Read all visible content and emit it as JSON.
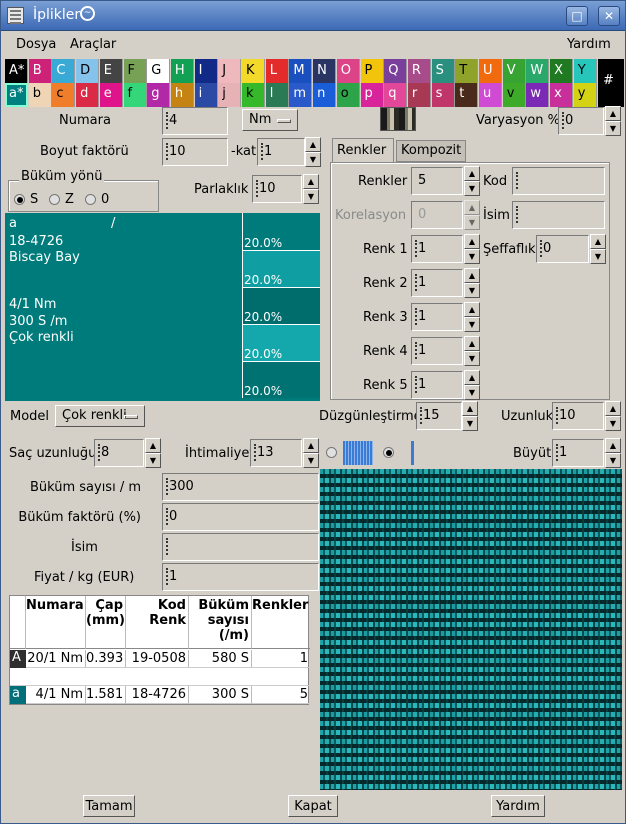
{
  "window": {
    "title": "İplikler"
  },
  "menubar": {
    "dosya": "Dosya",
    "araclar": "Araçlar",
    "yardim": "Yardım"
  },
  "palette": {
    "top": [
      {
        "label": "A*",
        "bg": "#000000",
        "fg": "#ffffff"
      },
      {
        "label": "B",
        "bg": "#cc2277",
        "fg": "#ffffff"
      },
      {
        "label": "C",
        "bg": "#39a9d6",
        "fg": "#ffffff"
      },
      {
        "label": "D",
        "bg": "#86c3ec",
        "fg": "#000000"
      },
      {
        "label": "E",
        "bg": "#444444",
        "fg": "#ffffff"
      },
      {
        "label": "F",
        "bg": "#77a255",
        "fg": "#000000"
      },
      {
        "label": "G",
        "bg": "#ffffff",
        "fg": "#000000"
      },
      {
        "label": "H",
        "bg": "#12a054",
        "fg": "#ffffff"
      },
      {
        "label": "I",
        "bg": "#112a88",
        "fg": "#ffffff"
      },
      {
        "label": "J",
        "bg": "#efb8bd",
        "fg": "#000000"
      },
      {
        "label": "K",
        "bg": "#f3d92a",
        "fg": "#000000"
      },
      {
        "label": "L",
        "bg": "#e42b2b",
        "fg": "#ffffff"
      },
      {
        "label": "M",
        "bg": "#1a4fc0",
        "fg": "#ffffff"
      },
      {
        "label": "N",
        "bg": "#2a3563",
        "fg": "#ffffff"
      },
      {
        "label": "O",
        "bg": "#dd4488",
        "fg": "#ffffff"
      },
      {
        "label": "P",
        "bg": "#f2c40c",
        "fg": "#000000"
      },
      {
        "label": "Q",
        "bg": "#7a3f9b",
        "fg": "#ffffff"
      },
      {
        "label": "R",
        "bg": "#a74b8a",
        "fg": "#ffffff"
      },
      {
        "label": "S",
        "bg": "#2a8f7e",
        "fg": "#ffffff"
      },
      {
        "label": "T",
        "bg": "#8fa32a",
        "fg": "#000000"
      },
      {
        "label": "U",
        "bg": "#f26a0e",
        "fg": "#ffffff"
      },
      {
        "label": "V",
        "bg": "#37a332",
        "fg": "#ffffff"
      },
      {
        "label": "W",
        "bg": "#2aa86a",
        "fg": "#ffffff"
      },
      {
        "label": "X",
        "bg": "#1f7a22",
        "fg": "#ffffff"
      },
      {
        "label": "Y",
        "bg": "#26c6bb",
        "fg": "#000000"
      }
    ],
    "bottom": [
      {
        "label": "a*",
        "bg": "#008080",
        "fg": "#ffffff"
      },
      {
        "label": "b",
        "bg": "#efd4b6",
        "fg": "#000000"
      },
      {
        "label": "c",
        "bg": "#ef7d2a",
        "fg": "#000000"
      },
      {
        "label": "d",
        "bg": "#db2a45",
        "fg": "#ffffff"
      },
      {
        "label": "e",
        "bg": "#e0148a",
        "fg": "#ffffff"
      },
      {
        "label": "f",
        "bg": "#34d67a",
        "fg": "#000000"
      },
      {
        "label": "g",
        "bg": "#b229a7",
        "fg": "#ffffff"
      },
      {
        "label": "h",
        "bg": "#c48312",
        "fg": "#ffffff"
      },
      {
        "label": "i",
        "bg": "#2b4aa5",
        "fg": "#ffffff"
      },
      {
        "label": "j",
        "bg": "#e6b2b6",
        "fg": "#000000"
      },
      {
        "label": "k",
        "bg": "#35b82a",
        "fg": "#000000"
      },
      {
        "label": "l",
        "bg": "#2a7a55",
        "fg": "#ffffff"
      },
      {
        "label": "m",
        "bg": "#2a59c9",
        "fg": "#ffffff"
      },
      {
        "label": "n",
        "bg": "#1a5dd9",
        "fg": "#ffffff"
      },
      {
        "label": "o",
        "bg": "#2da34a",
        "fg": "#000000"
      },
      {
        "label": "p",
        "bg": "#d8239a",
        "fg": "#ffffff"
      },
      {
        "label": "q",
        "bg": "#e3479a",
        "fg": "#ffffff"
      },
      {
        "label": "r",
        "bg": "#a73955",
        "fg": "#ffffff"
      },
      {
        "label": "s",
        "bg": "#c0366b",
        "fg": "#ffffff"
      },
      {
        "label": "t",
        "bg": "#4a2a1a",
        "fg": "#ffffff"
      },
      {
        "label": "u",
        "bg": "#d04bd3",
        "fg": "#ffffff"
      },
      {
        "label": "v",
        "bg": "#3eaa2a",
        "fg": "#000000"
      },
      {
        "label": "w",
        "bg": "#7a2ab5",
        "fg": "#ffffff"
      },
      {
        "label": "x",
        "bg": "#c92f9a",
        "fg": "#ffffff"
      },
      {
        "label": "y",
        "bg": "#d3d215",
        "fg": "#000000"
      }
    ],
    "extra": "#"
  },
  "left": {
    "numara_label": "Numara",
    "numara_value": "4",
    "numara_unit": "Nm",
    "boyut_label": "Boyut faktörü",
    "boyut_value": "10",
    "kat_label": "-kat",
    "kat_value": "1",
    "bukum_yonu_label": "Büküm yönü",
    "bukum_options": [
      "S",
      "Z",
      "0"
    ],
    "bukum_selected": "S",
    "parlaklik_label": "Parlaklık",
    "parlaklik_value": "10"
  },
  "varyasyon": {
    "label": "Varyasyon %",
    "value": "0"
  },
  "yarn_panel": {
    "line1_a": "a",
    "line1_b": "/",
    "line2": "18-4726",
    "line3": "Biscay Bay",
    "line4": "4/1 Nm",
    "line5": "300 S /m",
    "line6": "Çok renkli",
    "plies": [
      "20.0%",
      "20.0%",
      "20.0%",
      "20.0%",
      "20.0%"
    ],
    "ply_colors": [
      "#007b7b",
      "#0f9fa3",
      "#006d6d",
      "#14a8ac",
      "#007272"
    ]
  },
  "tabs": {
    "renkler": "Renkler",
    "kompozit": "Kompozit"
  },
  "renkler_tab": {
    "renkler_label": "Renkler",
    "renkler_value": "5",
    "korelasyon_label": "Korelasyon",
    "korelasyon_value": "0",
    "renk1_label": "Renk 1",
    "renk1_value": "1",
    "renk2_label": "Renk 2",
    "renk2_value": "1",
    "renk3_label": "Renk 3",
    "renk3_value": "1",
    "renk4_label": "Renk 4",
    "renk4_value": "1",
    "renk5_label": "Renk 5",
    "renk5_value": "1",
    "kod_label": "Kod",
    "kod_value": "",
    "isim_label": "İsim",
    "isim_value": "",
    "seffaflik_label": "Şeffaflık",
    "seffaflik_value": "0"
  },
  "model": {
    "label": "Model",
    "value": "Çok renkli"
  },
  "duzgun": {
    "label": "Düzgünleştirme",
    "value": "15"
  },
  "uzunluk": {
    "label": "Uzunluk",
    "value": "10"
  },
  "sac": {
    "label": "Saç uzunluğu",
    "value": "8"
  },
  "intimaliyet": {
    "label": "İhtimaliyet",
    "value": "13"
  },
  "buyut": {
    "label": "Büyüt",
    "value": "1"
  },
  "form": {
    "bukum_sayisi_label": "Büküm  sayısı / m",
    "bukum_sayisi_value": "300",
    "bukum_faktoru_label": "Büküm faktörü (%)",
    "bukum_faktoru_value": "0",
    "isim_label": "İsim",
    "isim_value": "",
    "fiyat_label": "Fiyat / kg (EUR)",
    "fiyat_value": "1"
  },
  "table": {
    "headers": [
      "Numara",
      "Çap\n(mm)",
      "Kod\nRenk",
      "Büküm\nsayısı\n(/m)",
      "Renkler"
    ],
    "rows": [
      {
        "mark": "A",
        "numara": "20/1 Nm",
        "cap": "0.393",
        "kod": "19-0508",
        "bukum": "580 S",
        "renkler": "1"
      },
      {
        "mark": "a",
        "numara": "4/1 Nm",
        "cap": "1.581",
        "kod": "18-4726",
        "bukum": "300 S",
        "renkler": "5"
      }
    ]
  },
  "buttons": {
    "tamam": "Tamam",
    "kapat": "Kapat",
    "yardim": "Yardım"
  }
}
